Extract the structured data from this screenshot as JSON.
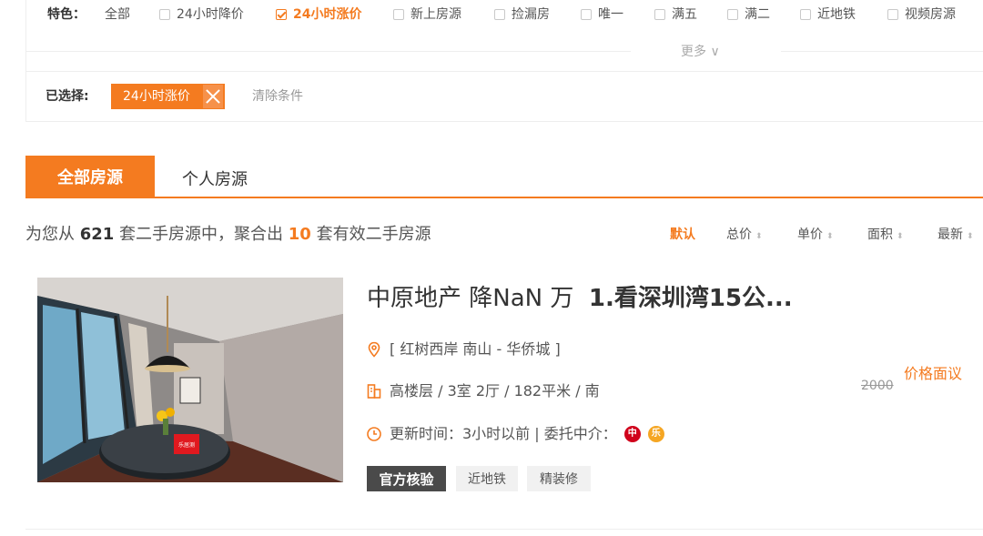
{
  "filters": {
    "label": "特色：",
    "options": [
      {
        "label": "全部",
        "checkbox": false,
        "checked": false
      },
      {
        "label": "24小时降价",
        "checkbox": true,
        "checked": false
      },
      {
        "label": "24小时涨价",
        "checkbox": true,
        "checked": true
      },
      {
        "label": "新上房源",
        "checkbox": true,
        "checked": false
      },
      {
        "label": "捡漏房",
        "checkbox": true,
        "checked": false
      },
      {
        "label": "唯一",
        "checkbox": true,
        "checked": false
      },
      {
        "label": "满五",
        "checkbox": true,
        "checked": false
      },
      {
        "label": "满二",
        "checkbox": true,
        "checked": false
      },
      {
        "label": "近地铁",
        "checkbox": true,
        "checked": false
      },
      {
        "label": "视频房源",
        "checkbox": true,
        "checked": false
      }
    ],
    "more": "更多 ∨"
  },
  "selected": {
    "label": "已选择:",
    "chip": "24小时涨价",
    "clear": "清除条件"
  },
  "tabs": {
    "all": "全部房源",
    "personal": "个人房源"
  },
  "summary": {
    "prefix": "为您从",
    "total": "621",
    "middle": "套二手房源中，聚合出",
    "count": "10",
    "suffix": "套有效二手房源"
  },
  "sort": {
    "default": "默认",
    "total_price": "总价",
    "unit_price": "单价",
    "area": "面积",
    "newest": "最新",
    "arrow": "⬍"
  },
  "listing": {
    "title_agency": "中原地产 降NaN 万",
    "title_main": "1.看深圳湾15公...",
    "location": "[ 红树西岸 南山 - 华侨城 ]",
    "details": "高楼层 / 3室 2厅 / 182平米 / 南",
    "updated": "更新时间：3小时以前 | 委托中介：",
    "agents": [
      {
        "char": "中",
        "color": "#d0021b"
      },
      {
        "char": "乐",
        "color": "#f5a623"
      }
    ],
    "price_negotiable": "价格面议",
    "price_old": "2000",
    "photo_badge": "乐居测",
    "official_badge": "官方核验",
    "tags": [
      "近地铁",
      "精装修"
    ]
  },
  "colors": {
    "accent": "#f47b20"
  }
}
